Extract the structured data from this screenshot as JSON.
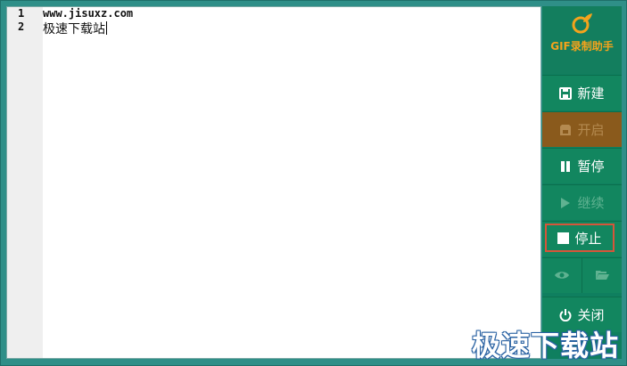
{
  "editor": {
    "lines": [
      {
        "number": "1",
        "text": "www.jisuxz.com"
      },
      {
        "number": "2",
        "text": "极速下载站"
      }
    ]
  },
  "panel": {
    "logo_text": "GIF录制助手",
    "buttons": {
      "new": "新建",
      "start": "开启",
      "pause": "暂停",
      "resume": "继续",
      "stop": "停止",
      "close": "关闭"
    }
  },
  "watermark": "极速下载站",
  "icons": {
    "logo": "leaf-logo-icon",
    "new": "save-icon",
    "start": "sd-card-icon",
    "pause": "pause-icon",
    "resume": "play-icon",
    "stop": "stop-square-icon",
    "preview": "eye-icon",
    "folder": "folder-open-icon",
    "close": "power-icon"
  },
  "colors": {
    "panel_bg": "#12865f",
    "start_bg": "#8a5a1c",
    "logo_text": "#f4a31c",
    "stop_border": "#d6553a"
  }
}
